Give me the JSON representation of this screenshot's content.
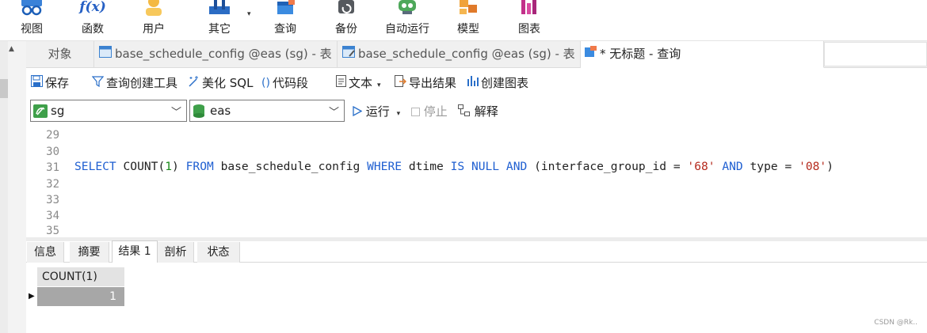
{
  "toolbar": {
    "items": [
      {
        "label": "视图",
        "icon": "view-icon"
      },
      {
        "label": "函数",
        "icon": "function-icon"
      },
      {
        "label": "用户",
        "icon": "user-icon"
      },
      {
        "label": "其它",
        "icon": "other-icon"
      },
      {
        "label": "查询",
        "icon": "query-icon"
      },
      {
        "label": "备份",
        "icon": "backup-icon"
      },
      {
        "label": "自动运行",
        "icon": "robot-icon"
      },
      {
        "label": "模型",
        "icon": "model-icon"
      },
      {
        "label": "图表",
        "icon": "chart-icon"
      }
    ],
    "function_icon_text": "f(x)",
    "dropdown_glyph": "▾"
  },
  "tabs": [
    {
      "label": "对象",
      "active": false
    },
    {
      "label": "base_schedule_config @eas (sg) - 表",
      "active": false
    },
    {
      "label": "base_schedule_config @eas (sg) - 表",
      "active": false
    },
    {
      "label": "* 无标题 - 查询",
      "active": true
    }
  ],
  "query_toolbar": {
    "save": "保存",
    "query_builder": "查询创建工具",
    "beautify": "美化 SQL",
    "snippet": "代码段",
    "text": "文本",
    "export": "导出结果",
    "create_chart": "创建图表",
    "snippet_glyph": "()"
  },
  "connection": {
    "connection_value": "sg",
    "database_value": "eas",
    "run": "运行",
    "stop": "停止",
    "explain": "解释",
    "dropdown_glyph": "▾",
    "chevron": "﹀"
  },
  "editor": {
    "line_numbers": [
      "29",
      "30",
      "31",
      "32",
      "33",
      "34",
      "35"
    ],
    "sql": {
      "select": "SELECT",
      "count": "COUNT(",
      "one": "1",
      "count_close": ")",
      "from": "FROM",
      "table": "base_schedule_config",
      "where": "WHERE",
      "col1": "dtime",
      "is": "IS",
      "null": "NULL",
      "and1": "AND",
      "open_paren": "(",
      "col2": "interface_group_id",
      "eq1": "=",
      "val1": "'68'",
      "and2": "AND",
      "col3": "type",
      "eq2": "=",
      "val2": "'08'",
      "close_paren": ")"
    }
  },
  "results": {
    "tabs": [
      {
        "label": "信息",
        "active": false
      },
      {
        "label": "摘要",
        "active": false
      },
      {
        "label": "结果 1",
        "active": true
      },
      {
        "label": "剖析",
        "active": false
      },
      {
        "label": "状态",
        "active": false
      }
    ],
    "column_header": "COUNT(1)",
    "cell_value": "1",
    "row_marker": "▶"
  },
  "watermark": "CSDN @Rk.."
}
